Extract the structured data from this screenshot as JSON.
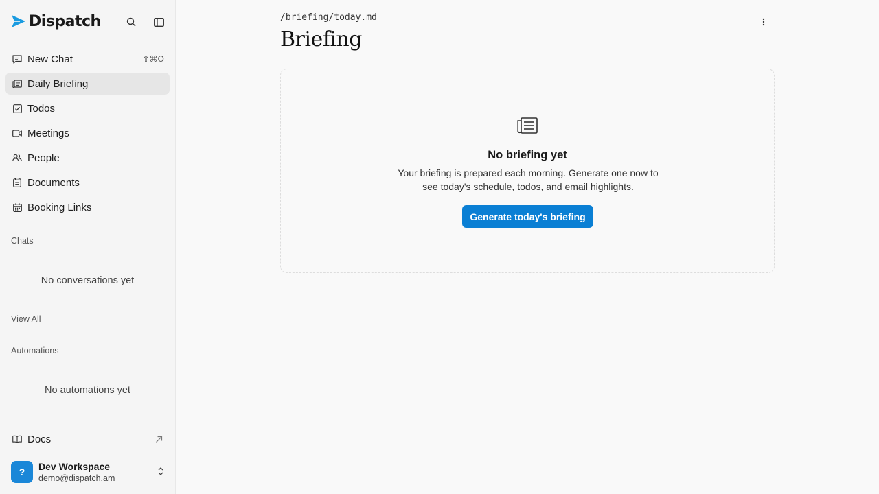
{
  "brand": {
    "name": "Dispatch",
    "accent": "#1a9be0"
  },
  "sidebar": {
    "search_icon": "search-icon",
    "toggle_icon": "sidebar-toggle-icon",
    "nav": [
      {
        "label": "New Chat",
        "icon": "chat-icon",
        "shortcut": "⇧⌘O"
      },
      {
        "label": "Daily Briefing",
        "icon": "newspaper-icon",
        "active": true
      },
      {
        "label": "Todos",
        "icon": "checkbox-icon"
      },
      {
        "label": "Meetings",
        "icon": "video-icon"
      },
      {
        "label": "People",
        "icon": "people-icon"
      },
      {
        "label": "Documents",
        "icon": "clipboard-icon"
      },
      {
        "label": "Booking Links",
        "icon": "calendar-icon"
      }
    ],
    "chats_label": "Chats",
    "chats_empty": "No conversations yet",
    "view_all": "View All",
    "automations_label": "Automations",
    "automations_empty": "No automations yet",
    "docs_label": "Docs",
    "workspace": {
      "avatar": "?",
      "name": "Dev Workspace",
      "email": "demo@dispatch.am",
      "avatar_color": "#1a87d8"
    }
  },
  "main": {
    "path": "/briefing/today.md",
    "title": "Briefing",
    "empty": {
      "heading": "No briefing yet",
      "description": "Your briefing is prepared each morning. Generate one now to see today's schedule, todos, and email highlights.",
      "button": "Generate today's briefing",
      "button_color": "#0a7fd4"
    }
  }
}
